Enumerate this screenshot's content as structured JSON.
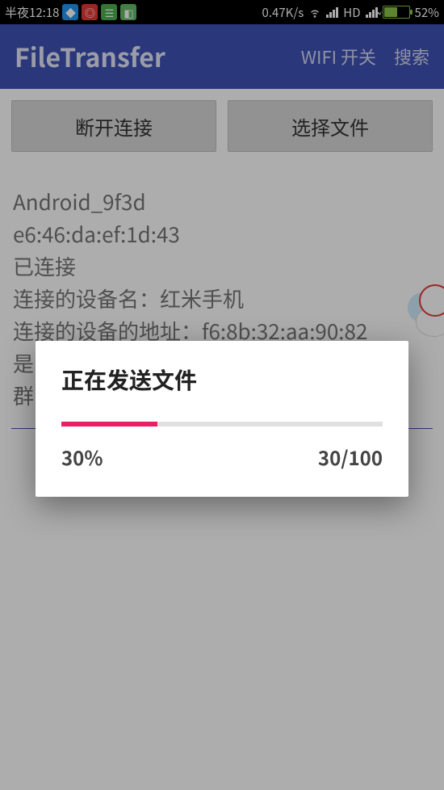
{
  "status_bar": {
    "time": "半夜12:18",
    "speed": "0.47K/s",
    "hd": "HD",
    "battery_pct": "52%"
  },
  "app_bar": {
    "title": "FileTransfer",
    "wifi_switch": "WIFI 开关",
    "search": "搜索"
  },
  "buttons": {
    "disconnect": "断开连接",
    "choose_file": "选择文件"
  },
  "info": {
    "device": "Android_9f3d",
    "mac": "e6:46:da:ef:1d:43",
    "status": "已连接",
    "peer_name_line": "连接的设备名：红米手机",
    "peer_addr_line": "连接的设备的地址：f6:8b:32:aa:90:82",
    "is_line": "是",
    "group_line": "群"
  },
  "dialog": {
    "title": "正在发送文件",
    "percent": "30%",
    "count": "30/100",
    "progress_width": "30%"
  }
}
